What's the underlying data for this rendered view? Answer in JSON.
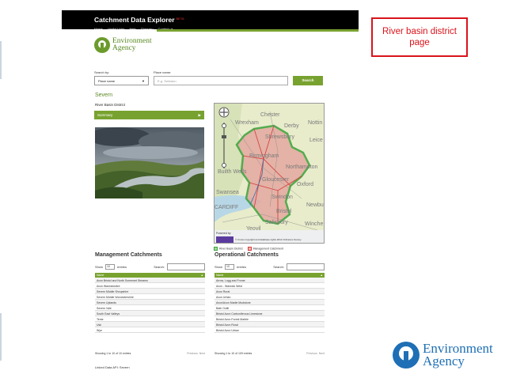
{
  "callout": {
    "line1": "River basin district",
    "line2": "page"
  },
  "brand": {
    "line1": "Environment",
    "line2": "Agency"
  },
  "header": {
    "title": "Catchment Data Explorer",
    "badge": "BETA",
    "nav": [
      "Home",
      "Useful Links",
      "Help",
      "Glossary",
      "Contact us"
    ]
  },
  "logo": {
    "line1": "Environment",
    "line2": "Agency"
  },
  "search": {
    "by_label": "Search by:",
    "by_value": "Place name",
    "place_label": "Place name:",
    "placeholder": "E.g. Swindon",
    "button": "Search"
  },
  "district": {
    "name": "Severn",
    "type": "River Basin District",
    "summary_label": "Summary"
  },
  "map": {
    "towns": [
      "Chester",
      "Wrexham",
      "Derby",
      "Nottin",
      "Shrewsbury",
      "Leice",
      "Birmingham",
      "Builth Wells",
      "Northampton",
      "Gloucester",
      "Oxford",
      "Swansea",
      "Swindon",
      "Newbu",
      "CARDIFF",
      "Bristol",
      "Yeovil",
      "Salisbury",
      "Winche"
    ],
    "powered_by": "Powered by",
    "copyright": "© Crown copyright and database rights 2014 Ordnance Survey",
    "legend": [
      "River Basin District",
      "Management Catchment"
    ],
    "colors": {
      "district": "#d63a3a",
      "boundary": "#3aa23a",
      "land": "#e8eccb"
    }
  },
  "management": {
    "title": "Management Catchments",
    "show": "Show",
    "entries_value": "10",
    "entries": "entries",
    "search": "Search:",
    "column": "Name",
    "rows": [
      "Avon Bristol and North Somerset Streams",
      "Avon Warwickshire",
      "Severn Middle Shropshire",
      "Severn Middle Worcestershire",
      "Severn Uplands",
      "Severn Vale",
      "South East Valleys",
      "Teme",
      "Usk",
      "Wye"
    ],
    "info": "Showing 1 to 10 of 10 entries",
    "previous": "Previous",
    "next": "Next"
  },
  "operational": {
    "title": "Operational Catchments",
    "show": "Show",
    "entries_value": "10",
    "entries": "entries",
    "search": "Search:",
    "column": "Name",
    "rows": [
      "Arrow, Lugg and Frome",
      "Avon - Warwick West",
      "Avon Rural",
      "Avon Urban",
      "Avon/Avon Marlie Mudstone",
      "Bath Ooliti",
      "Bristol Avon Carboniferous Limestone",
      "Bristol Avon Forest Marble",
      "Bristol Avon Rural",
      "Bristol Avon Urban"
    ],
    "info": "Showing 1 to 10 of 109 entries",
    "previous": "Previous",
    "next": "Next"
  },
  "linked": "Linked Data API: Severn"
}
